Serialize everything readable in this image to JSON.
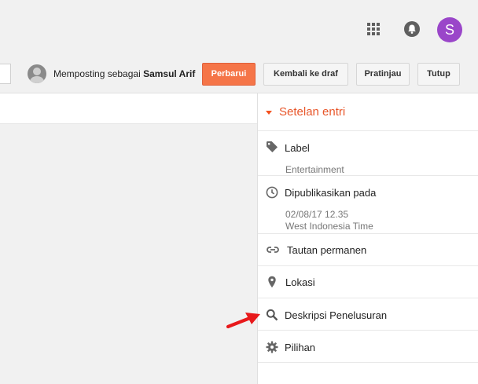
{
  "header": {
    "apps_icon": "apps-grid-icon",
    "notifications_icon": "bell-icon",
    "avatar_letter": "S",
    "avatar_color": "#9a46c9"
  },
  "toolbar": {
    "posting_as_prefix": "Memposting sebagai",
    "author_name": "Samsul Arif",
    "update_label": "Perbarui",
    "revert_draft_label": "Kembali ke draf",
    "preview_label": "Pratinjau",
    "close_label": "Tutup",
    "accent_color": "#f57548"
  },
  "sidebar": {
    "title": "Setelan entri",
    "items": [
      {
        "icon": "tag-icon",
        "label": "Label",
        "sub": [
          "Entertainment"
        ]
      },
      {
        "icon": "clock-icon",
        "label": "Dipublikasikan pada",
        "sub": [
          "02/08/17 12.35",
          "West Indonesia Time"
        ]
      },
      {
        "icon": "link-icon",
        "label": "Tautan permanen"
      },
      {
        "icon": "location-pin-icon",
        "label": "Lokasi"
      },
      {
        "icon": "search-icon",
        "label": "Deskripsi Penelusuran"
      },
      {
        "icon": "gear-icon",
        "label": "Pilihan"
      }
    ]
  },
  "annotation": {
    "arrow_color": "#e8191b",
    "arrow_icon": "red-arrow-icon"
  }
}
